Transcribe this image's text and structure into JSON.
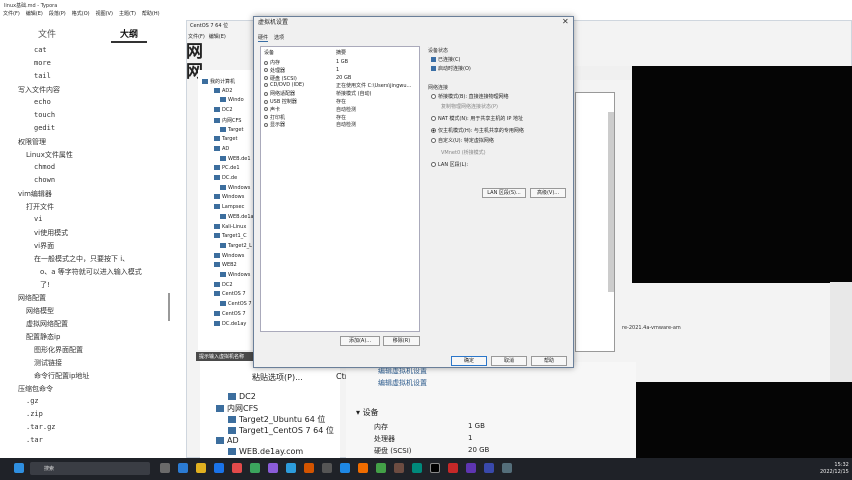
{
  "typora": {
    "title": "linux基础.md - Typora",
    "menu": [
      "文件(F)",
      "编辑(E)",
      "段落(P)",
      "格式(O)",
      "视图(V)",
      "主题(T)",
      "帮助(H)"
    ],
    "tab_files": "文件",
    "tab_outline": "大纲",
    "outline": [
      {
        "text": "cat",
        "indent": 34,
        "mono": true
      },
      {
        "text": "more",
        "indent": 34,
        "mono": true
      },
      {
        "text": "tail",
        "indent": 34,
        "mono": true
      },
      {
        "text": "写入文件内容",
        "indent": 18,
        "mono": false
      },
      {
        "text": "echo",
        "indent": 34,
        "mono": true
      },
      {
        "text": "touch",
        "indent": 34,
        "mono": true
      },
      {
        "text": "gedit",
        "indent": 34,
        "mono": true
      },
      {
        "text": "权限管理",
        "indent": 18,
        "mono": false
      },
      {
        "text": "Linux文件属性",
        "indent": 26,
        "mono": false
      },
      {
        "text": "chmod",
        "indent": 34,
        "mono": true
      },
      {
        "text": "chown",
        "indent": 34,
        "mono": true
      },
      {
        "text": "vim编辑器",
        "indent": 18,
        "mono": false
      },
      {
        "text": "打开文件",
        "indent": 26,
        "mono": false
      },
      {
        "text": "vi",
        "indent": 34,
        "mono": true
      },
      {
        "text": "vi使用模式",
        "indent": 34,
        "mono": false
      },
      {
        "text": "vi界面",
        "indent": 34,
        "mono": false
      },
      {
        "text": "在一般模式之中，只要按下 i、",
        "indent": 34,
        "mono": false
      },
      {
        "text": "o、a 等字符就可以进入输入模式",
        "indent": 40,
        "mono": false
      },
      {
        "text": "了!",
        "indent": 40,
        "mono": false
      },
      {
        "text": "网络配置",
        "indent": 18,
        "mono": false
      },
      {
        "text": "网络模型",
        "indent": 26,
        "mono": false
      },
      {
        "text": "虚拟网络配置",
        "indent": 26,
        "mono": false
      },
      {
        "text": "配置静态ip",
        "indent": 26,
        "mono": false
      },
      {
        "text": "图形化界面配置",
        "indent": 34,
        "mono": false
      },
      {
        "text": "测试链接",
        "indent": 34,
        "mono": false
      },
      {
        "text": "命令行配置ip地址",
        "indent": 34,
        "mono": false
      },
      {
        "text": "压缩包命令",
        "indent": 18,
        "mono": false
      },
      {
        "text": ".gz",
        "indent": 26,
        "mono": true
      },
      {
        "text": ".zip",
        "indent": 26,
        "mono": true
      },
      {
        "text": ".tar.gz",
        "indent": 26,
        "mono": true
      },
      {
        "text": ".tar",
        "indent": 26,
        "mono": true
      }
    ]
  },
  "vmware": {
    "title": "CentOS 7 64 位",
    "menu": [
      "文件(F)",
      "编辑(E)"
    ],
    "big_text": [
      "网",
      "网"
    ],
    "library_search": "在此处键入内容",
    "library_tree": [
      "我的计算机",
      "AD2",
      "Windo",
      "DC2",
      "内网CFS",
      "Target",
      "Target",
      "AD",
      "WEB.de1",
      "PC.de1",
      "DC.de",
      "Windows",
      "Windows",
      "Lampsec",
      "WEB.de1a",
      "Kali-Linux",
      "Target1_C",
      "Target2_L",
      "Windows",
      "WEB2",
      "Windows",
      "DC2",
      "CentOS 7",
      "CentOS 7",
      "CentOS 7",
      "DC.de1ay"
    ],
    "url_line": "re-2021.4a-vmware-am",
    "lower_header": "提示输入虚拟机名称",
    "lower_tree": [
      "DC2",
      "内网CFS",
      "Target2_Ubuntu 64 位",
      "Target1_CentOS 7 64 位",
      "AD",
      "WEB.de1ay.com"
    ],
    "context_menu_label": "粘贴选项(P)...",
    "context_menu_shortcut": "Ctrl+P",
    "details_links": [
      "编辑虚拟机设置",
      "编辑虚拟机设置"
    ],
    "details_section": "设备",
    "details": [
      {
        "name": "内存",
        "value": "1 GB"
      },
      {
        "name": "处理器",
        "value": "1"
      },
      {
        "name": "硬盘 (SCSI)",
        "value": "20 GB"
      }
    ]
  },
  "dialog": {
    "title": "虚拟机设置",
    "close": "✕",
    "tabs": [
      "硬件",
      "选项"
    ],
    "col_device": "设备",
    "col_summary": "摘要",
    "devices": [
      {
        "name": "内存",
        "summary": "1 GB"
      },
      {
        "name": "处理器",
        "summary": "1"
      },
      {
        "name": "硬盘 (SCSI)",
        "summary": "20 GB"
      },
      {
        "name": "CD/DVD (IDE)",
        "summary": "正在使用文件 C:\\Users\\jingwu..."
      },
      {
        "name": "网络适配器",
        "summary": "桥接模式 (自动)"
      },
      {
        "name": "USB 控制器",
        "summary": "存在"
      },
      {
        "name": "声卡",
        "summary": "自动检测"
      },
      {
        "name": "打印机",
        "summary": "存在"
      },
      {
        "name": "显示器",
        "summary": "自动检测"
      }
    ],
    "add_button": "添加(A)...",
    "remove_button": "移除(R)",
    "device_status_title": "设备状态",
    "status_connected": "已连接(C)",
    "status_on_start": "启动时连接(O)",
    "net_conn_title": "网络连接",
    "options": [
      {
        "label": "桥接模式(B): 直接连接物理网络",
        "on": false,
        "muted": false
      },
      {
        "label": "复制物理网络连接状态(P)",
        "on": false,
        "muted": true
      },
      {
        "label": "NAT 模式(N): 用于共享主机的 IP 地址",
        "on": false,
        "muted": false
      },
      {
        "label": "仅主机模式(H): 与主机共享的专用网络",
        "on": true,
        "muted": false
      },
      {
        "label": "自定义(U): 特定虚拟网络",
        "on": false,
        "muted": false
      },
      {
        "label": "VMnet0 (桥接模式)",
        "on": false,
        "muted": true
      },
      {
        "label": "LAN 区段(L):",
        "on": false,
        "muted": false
      }
    ],
    "lan_seg_button": "LAN 区段(S)...",
    "advanced_button": "高级(V)...",
    "ok_button": "确定",
    "cancel_button": "取消",
    "help_button": "帮助"
  },
  "taskbar": {
    "search": "搜索",
    "time": "15:32",
    "date": "2022/12/15"
  }
}
